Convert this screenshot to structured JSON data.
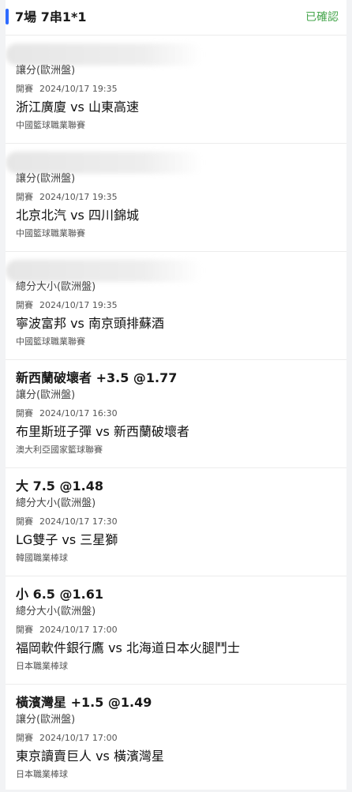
{
  "header": {
    "title": "7場 7串1*1",
    "status": "已確認",
    "accent_color": "#2f6bff",
    "status_color": "#46a64c"
  },
  "kickoff_label": "開賽",
  "bets": [
    {
      "pick": "",
      "market": "讓分(歐洲盤)",
      "kickoff": "2024/10/17 19:35",
      "match": "浙江廣廈 vs 山東高速",
      "league": "中國籃球職業聯賽",
      "pick_obscured": true
    },
    {
      "pick": "",
      "market": "讓分(歐洲盤)",
      "kickoff": "2024/10/17 19:35",
      "match": "北京北汽 vs 四川錦城",
      "league": "中國籃球職業聯賽",
      "pick_obscured": true
    },
    {
      "pick": "",
      "market": "總分大小(歐洲盤)",
      "kickoff": "2024/10/17 19:35",
      "match": "寧波富邦 vs 南京頭排蘇酒",
      "league": "中國籃球職業聯賽",
      "pick_obscured": true
    },
    {
      "pick": "新西蘭破壞者 +3.5 @1.77",
      "market": "讓分(歐洲盤)",
      "kickoff": "2024/10/17 16:30",
      "match": "布里斯班子彈 vs 新西蘭破壞者",
      "league": "澳大利亞國家籃球聯賽",
      "pick_obscured": false
    },
    {
      "pick": "大 7.5 @1.48",
      "market": "總分大小(歐洲盤)",
      "kickoff": "2024/10/17 17:30",
      "match": "LG雙子 vs 三星獅",
      "league": "韓國職業棒球",
      "pick_obscured": false
    },
    {
      "pick": "小 6.5 @1.61",
      "market": "總分大小(歐洲盤)",
      "kickoff": "2024/10/17 17:00",
      "match": "福岡軟件銀行鷹 vs 北海道日本火腿鬥士",
      "league": "日本職業棒球",
      "pick_obscured": false
    },
    {
      "pick": "橫濱灣星 +1.5 @1.49",
      "market": "讓分(歐洲盤)",
      "kickoff": "2024/10/17 17:00",
      "match": "東京讀賣巨人 vs 橫濱灣星",
      "league": "日本職業棒球",
      "pick_obscured": false
    }
  ]
}
